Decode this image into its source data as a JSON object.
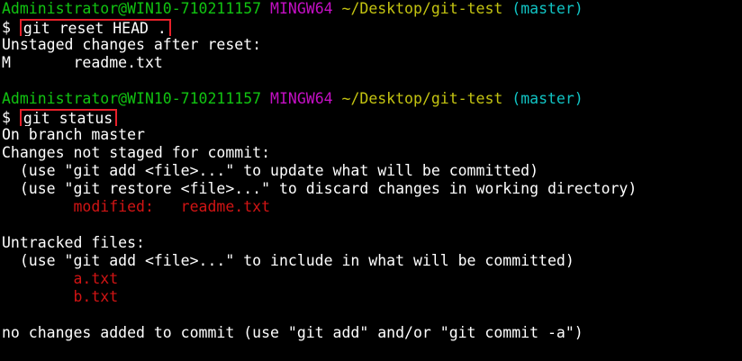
{
  "prompt": {
    "user_host": "Administrator@WIN10-710211157",
    "system": "MINGW64",
    "path": "~/Desktop/git-test",
    "branch": "(master)",
    "symbol": "$"
  },
  "colors": {
    "background": "#000000",
    "user_host": "#11c411",
    "system": "#c40fc4",
    "path": "#c4c411",
    "branch": "#11c4c4",
    "highlight_box": "#e8202a",
    "modified": "#d11414"
  },
  "block1": {
    "command": "git reset HEAD .",
    "output_header": "Unstaged changes after reset:",
    "status_code": "M",
    "status_file": "readme.txt"
  },
  "block2": {
    "command": "git status",
    "on_branch": "On branch master",
    "not_staged_header": "Changes not staged for commit:",
    "hint_add": "  (use \"git add <file>...\" to update what will be committed)",
    "hint_restore": "  (use \"git restore <file>...\" to discard changes in working directory)",
    "modified_label": "        modified:   readme.txt",
    "untracked_header": "Untracked files:",
    "hint_include": "  (use \"git add <file>...\" to include in what will be committed)",
    "untracked_files": [
      "        a.txt",
      "        b.txt"
    ],
    "footer": "no changes added to commit (use \"git add\" and/or \"git commit -a\")"
  }
}
